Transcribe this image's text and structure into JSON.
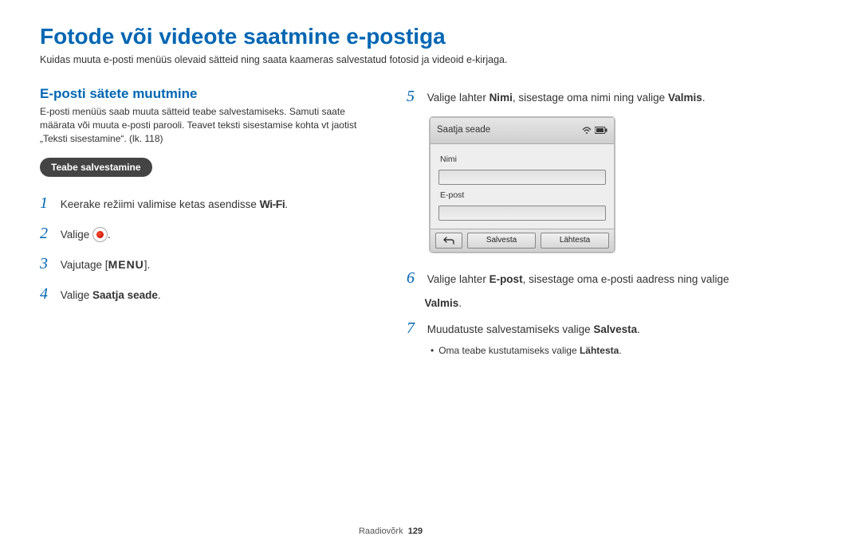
{
  "title": "Fotode või videote saatmine e-postiga",
  "subtitle": "Kuidas muuta e-posti menüüs olevaid sätteid ning saata kaameras salvestatud fotosid ja videoid e-kirjaga.",
  "left": {
    "h2": "E-posti sätete muutmine",
    "para": "E-posti menüüs saab muuta sätteid teabe salvestamiseks. Samuti saate määrata või muuta e-posti parooli. Teavet teksti sisestamise kohta vt jaotist „Teksti sisestamine“. (lk. 118)",
    "pill": "Teabe salvestamine",
    "step1_pre": "Keerake režiimi valimise ketas asendisse ",
    "step1_wifi": "Wi-Fi",
    "step2_pre": "Valige ",
    "step3_pre": "Vajutage [",
    "step3_menu": "MENU",
    "step3_post": "].",
    "step4_pre": "Valige ",
    "step4_bold": "Saatja seade",
    "step4_post": "."
  },
  "right": {
    "step5_pre": "Valige lahter ",
    "step5_b1": "Nimi",
    "step5_mid": ", sisestage oma nimi ning valige ",
    "step5_b2": "Valmis",
    "step5_post": ".",
    "screenshot": {
      "header": "Saatja seade",
      "field1": "Nimi",
      "field2": "E-post",
      "btn_save": "Salvesta",
      "btn_reset": "Lähtesta"
    },
    "step6_pre": "Valige lahter ",
    "step6_b1": "E-post",
    "step6_mid": ", sisestage oma e-posti aadress ning valige ",
    "step6_b2": "Valmis",
    "step6_post": ".",
    "step7_pre": "Muudatuste salvestamiseks valige ",
    "step7_b1": "Salvesta",
    "step7_post": ".",
    "bullet_pre": "Oma teabe kustutamiseks valige ",
    "bullet_b": "Lähtesta",
    "bullet_post": "."
  },
  "footer": {
    "section": "Raadiovõrk",
    "page": "129"
  }
}
